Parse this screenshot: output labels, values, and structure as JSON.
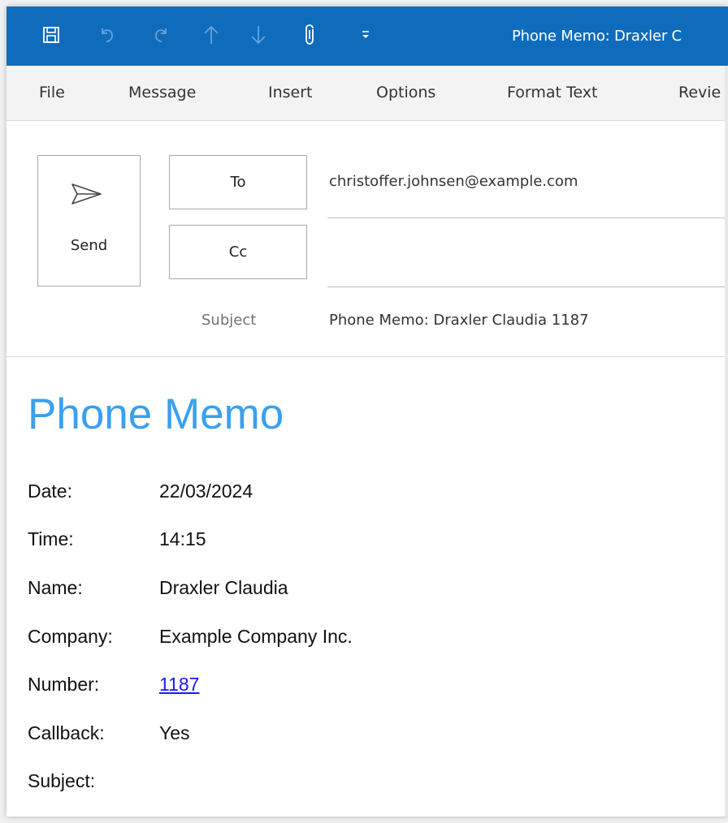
{
  "window": {
    "title": "Phone Memo: Draxler C",
    "accent": "#0f6cbd",
    "quick_access": [
      {
        "icon": "save-icon"
      },
      {
        "icon": "undo-icon"
      },
      {
        "icon": "redo-icon"
      },
      {
        "icon": "arrow-up-icon"
      },
      {
        "icon": "arrow-down-icon"
      },
      {
        "icon": "attach-icon"
      },
      {
        "icon": "customize-toolbar-icon"
      }
    ]
  },
  "menu": {
    "items": [
      "File",
      "Message",
      "Insert",
      "Options",
      "Format Text",
      "Revie"
    ]
  },
  "compose": {
    "send_label": "Send",
    "to_label": "To",
    "cc_label": "Cc",
    "to_value": "christoffer.johnsen@example.com",
    "cc_value": "",
    "subject_label": "Subject",
    "subject_value": "Phone Memo: Draxler Claudia  1187"
  },
  "memo": {
    "title": "Phone Memo",
    "title_color": "#3aa0f0",
    "rows": [
      {
        "label": "Date:",
        "value": "22/03/2024"
      },
      {
        "label": "Time:",
        "value": "14:15"
      },
      {
        "label": "Name:",
        "value": "Draxler Claudia"
      },
      {
        "label": "Company:",
        "value": "Example Company Inc."
      },
      {
        "label": "Number:",
        "value": "1187"
      },
      {
        "label": "Callback:",
        "value": "Yes"
      },
      {
        "label": "Subject:",
        "value": ""
      }
    ]
  }
}
